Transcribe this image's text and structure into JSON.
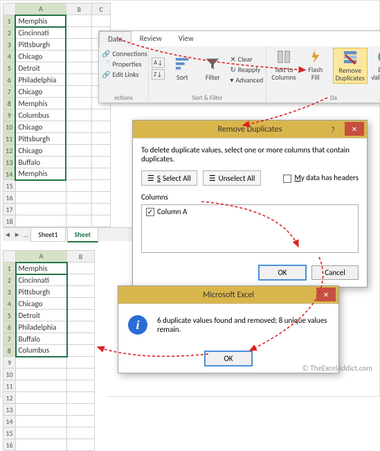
{
  "grid1": {
    "cols": [
      "A",
      "B",
      "C"
    ],
    "rows": [
      "Memphis",
      "Cincinnati",
      "Pittsburgh",
      "Chicago",
      "Detroit",
      "Philadelphia",
      "Chicago",
      "Memphis",
      "Columbus",
      "Chicago",
      "Pittsburgh",
      "Chicago",
      "Buffalo",
      "Memphis",
      "",
      "",
      "",
      ""
    ],
    "row_nums": [
      1,
      2,
      3,
      4,
      5,
      6,
      7,
      8,
      9,
      10,
      11,
      12,
      13,
      14,
      15,
      16,
      17,
      18
    ],
    "tabs": {
      "nav": "...",
      "t1": "Sheet1",
      "t2": "Sheet"
    }
  },
  "grid2": {
    "cols": [
      "A",
      "B"
    ],
    "rows": [
      "Memphis",
      "Cincinnati",
      "Pittsburgh",
      "Chicago",
      "Detroit",
      "Philadelphia",
      "Buffalo",
      "Columbus",
      "",
      "",
      "",
      "",
      "",
      "",
      "",
      ""
    ],
    "row_nums": [
      1,
      2,
      3,
      4,
      5,
      6,
      7,
      8,
      9,
      10,
      11,
      12,
      13,
      14,
      15,
      16
    ]
  },
  "ribbon": {
    "tabs": {
      "data": "Data",
      "review": "Review",
      "view": "View"
    },
    "conn": {
      "a": "Connections",
      "b": "Properties",
      "c": "Edit Links",
      "label": "ections"
    },
    "sort": {
      "az": "A↓Z",
      "za": "Z↓A",
      "sort": "Sort",
      "filter": "Filter",
      "clear": "Clear",
      "reapply": "Reapply",
      "advanced": "Advanced",
      "label": "Sort & Filter"
    },
    "tools": {
      "ttc": "Text to Columns",
      "flash": "Flash Fill",
      "remdup": "Remove Duplicates",
      "valid": "Data Validation",
      "label": "Da"
    }
  },
  "dlg_dup": {
    "title": "Remove Duplicates",
    "instr": "To delete duplicate values, select one or more columns that contain duplicates.",
    "select_all": "Select All",
    "unselect_all": "Unselect All",
    "headers_pre": "M",
    "headers_suf": "y data has headers",
    "cols_label": "Columns",
    "col_item": "Column A",
    "ok": "OK",
    "cancel": "Cancel",
    "help": "?",
    "close": "✕"
  },
  "dlg_msg": {
    "title": "Microsoft Excel",
    "text": "6 duplicate values found and removed; 8 unique values remain.",
    "ok": "OK",
    "close": "✕"
  },
  "watermark": "© TheExcelAddict.com"
}
